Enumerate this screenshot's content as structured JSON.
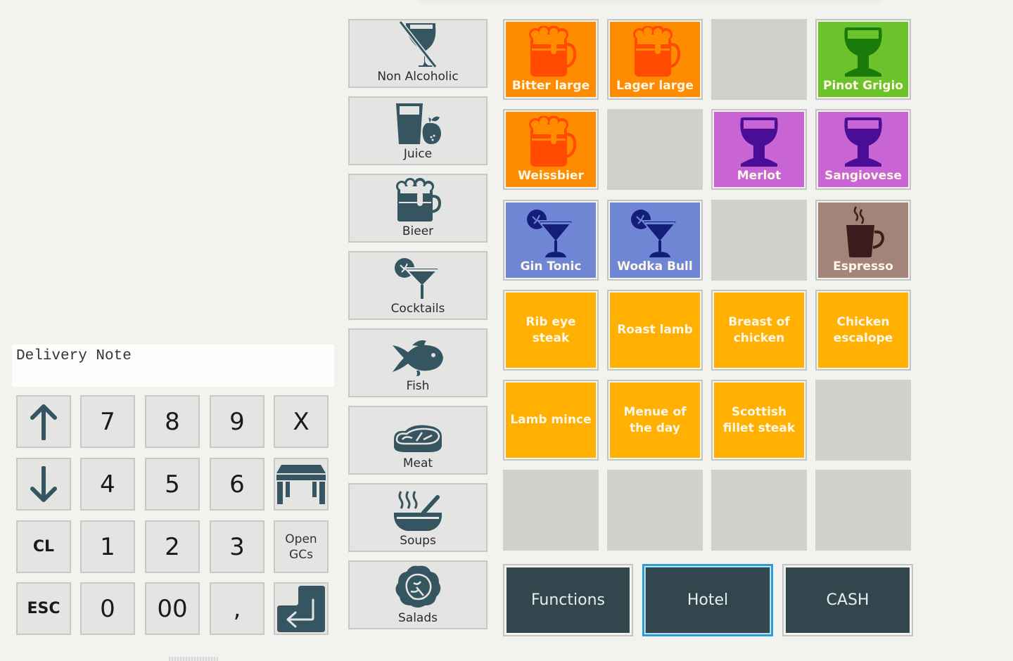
{
  "note": {
    "text": "Delivery Note"
  },
  "keypad": {
    "up": "up-arrow",
    "down": "down-arrow",
    "k7": "7",
    "k8": "8",
    "k9": "9",
    "x": "X",
    "k4": "4",
    "k5": "5",
    "k6": "6",
    "table": "table-icon",
    "cl": "CL",
    "k1": "1",
    "k2": "2",
    "k3": "3",
    "open_gcs": "Open GCs",
    "esc": "ESC",
    "k0": "0",
    "k00": "00",
    "comma": ",",
    "enter": "enter-icon"
  },
  "categories": [
    {
      "label": "Non Alcoholic",
      "icon": "no-alcohol-icon"
    },
    {
      "label": "Juice",
      "icon": "juice-icon"
    },
    {
      "label": "Bieer",
      "icon": "beer-icon"
    },
    {
      "label": "Cocktails",
      "icon": "cocktail-icon"
    },
    {
      "label": "Fish",
      "icon": "fish-icon"
    },
    {
      "label": "Meat",
      "icon": "steak-icon"
    },
    {
      "label": "Soups",
      "icon": "soup-icon"
    },
    {
      "label": "Salads",
      "icon": "salad-icon"
    }
  ],
  "products": [
    {
      "label": "Bitter large",
      "icon": "beer-icon",
      "color": "#ff8c00",
      "iconColor": "#ff4a00"
    },
    {
      "label": "Lager large",
      "icon": "beer-icon",
      "color": "#ff8c00",
      "iconColor": "#ff4a00"
    },
    {
      "label": "",
      "empty": true
    },
    {
      "label": "Pinot Grigio",
      "icon": "wine-glass-icon",
      "color": "#6cc22a",
      "iconColor": "#1a7a0a"
    },
    {
      "label": "Weissbier",
      "icon": "beer-icon",
      "color": "#ff8c00",
      "iconColor": "#ff4a00"
    },
    {
      "label": "",
      "empty": true
    },
    {
      "label": "Merlot",
      "icon": "wine-glass-icon",
      "color": "#c864d4",
      "iconColor": "#4a0e96"
    },
    {
      "label": "Sangiovese",
      "icon": "wine-glass-icon",
      "color": "#c864d4",
      "iconColor": "#4a0e96"
    },
    {
      "label": "Gin Tonic",
      "icon": "cocktail-icon",
      "color": "#6e86d4",
      "iconColor": "#141e7a"
    },
    {
      "label": "Wodka Bull",
      "icon": "cocktail-icon",
      "color": "#6e86d4",
      "iconColor": "#141e7a"
    },
    {
      "label": "",
      "empty": true
    },
    {
      "label": "Espresso",
      "icon": "coffee-cup-icon",
      "color": "#a48478",
      "iconColor": "#3c1c1c"
    },
    {
      "label": "Rib eye steak",
      "color": "#ffb000"
    },
    {
      "label": "Roast lamb",
      "color": "#ffb000"
    },
    {
      "label": "Breast of chicken",
      "color": "#ffb000"
    },
    {
      "label": "Chicken escalope",
      "color": "#ffb000"
    },
    {
      "label": "Lamb mince",
      "color": "#ffb000"
    },
    {
      "label": "Menue of the day",
      "color": "#ffb000"
    },
    {
      "label": "Scottish fillet steak",
      "color": "#ffb000"
    },
    {
      "label": "",
      "empty": true
    },
    {
      "label": "",
      "empty": true
    },
    {
      "label": "",
      "empty": true
    },
    {
      "label": "",
      "empty": true
    },
    {
      "label": "",
      "empty": true
    }
  ],
  "functions": {
    "functions_label": "Functions",
    "hotel_label": "Hotel",
    "cash_label": "CASH"
  },
  "colors": {
    "icon_dark": "#355560",
    "func_bg": "#32474d",
    "selected_border": "#2a9ad8",
    "empty_tile": "#d0d0cc"
  }
}
